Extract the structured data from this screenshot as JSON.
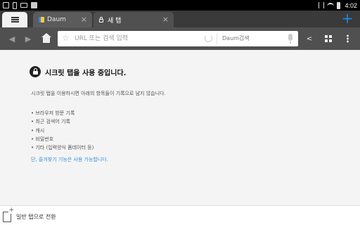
{
  "status_bar": {
    "time": "4:02",
    "icons_left": [
      "screenshot-icon",
      "phone-icon",
      "mail-icon",
      "check-icon"
    ],
    "icons_right": [
      "vibrate-icon",
      "wifi-icon",
      "battery-icon"
    ]
  },
  "tabs": [
    {
      "label": "Daum",
      "close": "×",
      "active": false
    },
    {
      "label": "새 탭",
      "close": "×",
      "active": true
    }
  ],
  "toolbar": {
    "new_tab_icon": "+",
    "back_icon": "◀",
    "forward_icon": "▶",
    "url_placeholder": "URL 또는 검색 입력",
    "search_engine": "Daum검색",
    "share_icon": "<"
  },
  "secret": {
    "heading": "시크릿 탭을 사용 중입니다.",
    "description": "시크릿 탭을 이용하시면 아래의 항목들이 기록으로 남지 않습니다.",
    "items": [
      "• 브라우저 방문 기록",
      "• 최근 검색어 기록",
      "• 캐시",
      "• 비밀번호",
      "• 기타 (입력양식 폼데이터 등)"
    ],
    "note": "단, 즐겨찾기 기능은 사용 가능합니다."
  },
  "bottom": {
    "switch_label": "일반 탭으로 전환"
  },
  "colors": {
    "tabstrip": "#3a3a3a",
    "toolbar": "#505050",
    "accent": "#1e88e5",
    "link": "#3a8fd6"
  }
}
